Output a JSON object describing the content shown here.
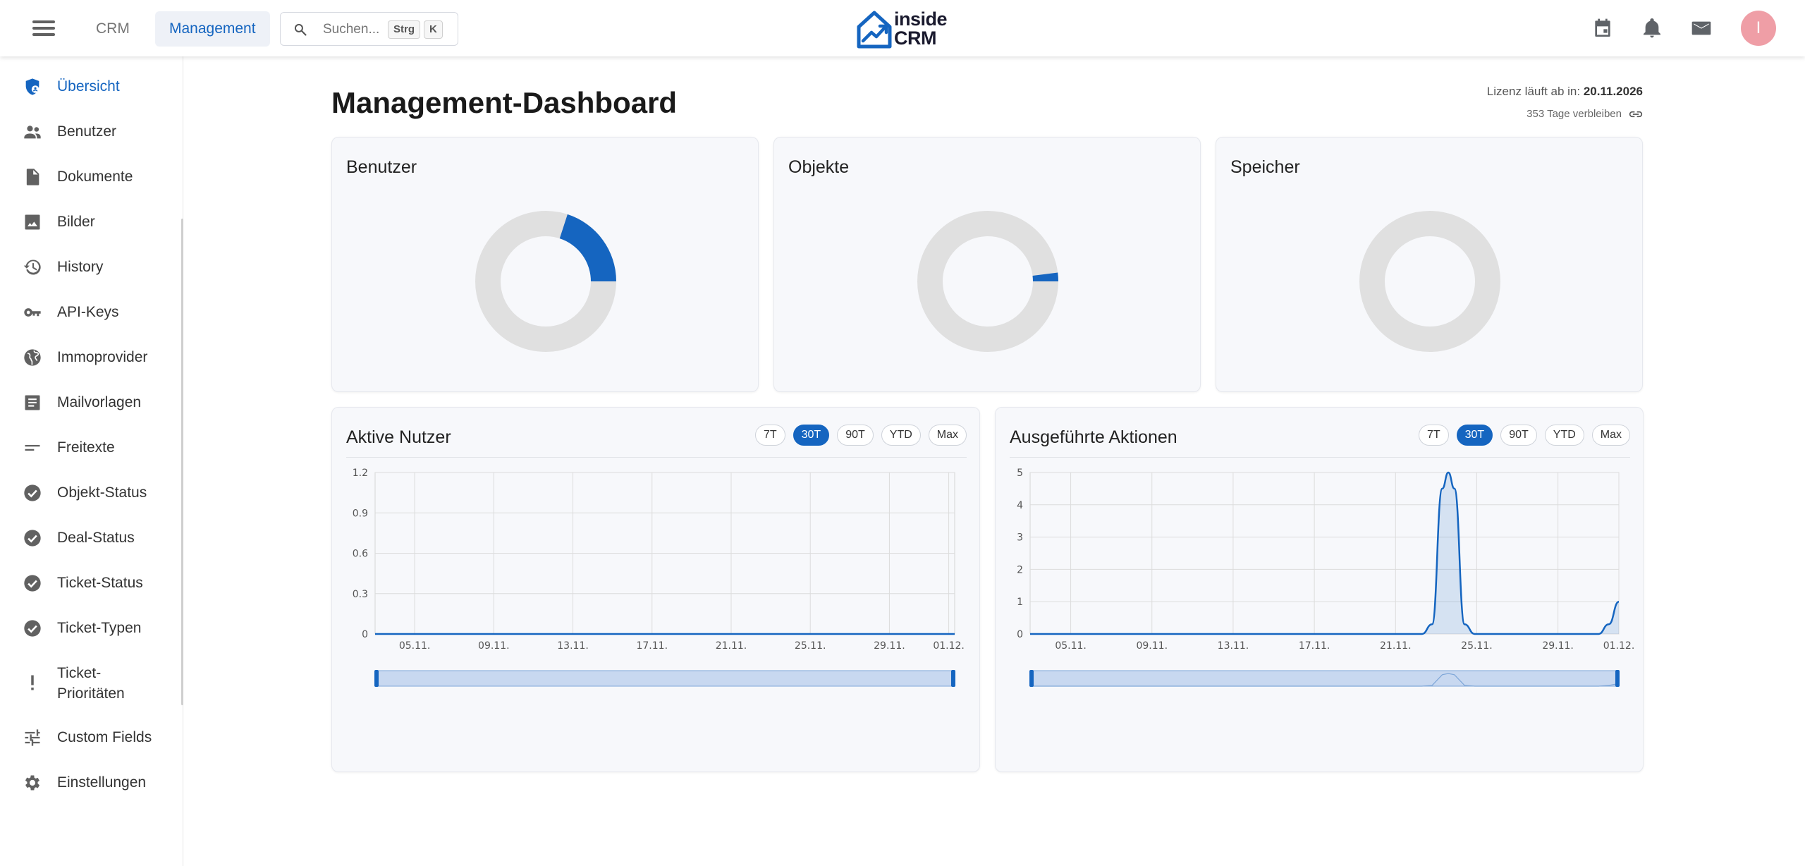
{
  "header": {
    "nav_crm": "CRM",
    "nav_management": "Management",
    "search_placeholder": "Suchen...",
    "kbd_1": "Strg",
    "kbd_2": "K",
    "logo_line1": "inside",
    "logo_line2": "CRM",
    "avatar_initial": "I",
    "avatar_color": "#ef9ea6",
    "icons": [
      "calendar-icon",
      "bell-icon",
      "mail-icon"
    ]
  },
  "sidebar": {
    "items": [
      {
        "label": "Übersicht",
        "icon": "shield-person-icon",
        "active": true
      },
      {
        "label": "Benutzer",
        "icon": "people-icon"
      },
      {
        "label": "Dokumente",
        "icon": "document-icon"
      },
      {
        "label": "Bilder",
        "icon": "image-icon"
      },
      {
        "label": "History",
        "icon": "history-icon"
      },
      {
        "label": "API-Keys",
        "icon": "key-icon"
      },
      {
        "label": "Immoprovider",
        "icon": "globe-icon"
      },
      {
        "label": "Mailvorlagen",
        "icon": "article-icon"
      },
      {
        "label": "Freitexte",
        "icon": "short-text-icon"
      },
      {
        "label": "Objekt-Status",
        "icon": "check-circle-icon"
      },
      {
        "label": "Deal-Status",
        "icon": "check-circle-icon"
      },
      {
        "label": "Ticket-Status",
        "icon": "check-circle-icon"
      },
      {
        "label": "Ticket-Typen",
        "icon": "check-circle-icon"
      },
      {
        "label": "Ticket-Prioritäten",
        "label_line1": "Ticket-",
        "label_line2": "Prioritäten",
        "icon": "exclamation-icon"
      },
      {
        "label": "Custom Fields",
        "icon": "tune-icon"
      },
      {
        "label": "Einstellungen",
        "icon": "gear-icon"
      }
    ]
  },
  "main": {
    "title": "Management-Dashboard",
    "license_label": "Lizenz läuft ab in:",
    "license_date": "20.11.2026",
    "days_remaining": "353 Tage verbleiben"
  },
  "colors": {
    "accent": "#1565c0",
    "donut_track": "#e0e0e0"
  },
  "cards": {
    "donuts": [
      {
        "title": "Benutzer",
        "fraction": 0.2
      },
      {
        "title": "Objekte",
        "fraction": 0.02
      },
      {
        "title": "Speicher",
        "fraction": 0.0
      }
    ]
  },
  "range_chips": [
    "7T",
    "30T",
    "90T",
    "YTD",
    "Max"
  ],
  "selected_chip": "30T",
  "chart_data": [
    {
      "type": "line",
      "title": "Aktive Nutzer",
      "x": [
        "05.11.",
        "09.11.",
        "13.11.",
        "17.11.",
        "21.11.",
        "25.11.",
        "29.11.",
        "01.12."
      ],
      "x_tick_days": [
        5,
        9,
        13,
        17,
        21,
        25,
        29,
        32
      ],
      "x_range_days": [
        3,
        32.3
      ],
      "yticks": [
        "0",
        "0.3",
        "0.6",
        "0.9",
        "1.2"
      ],
      "ylim": [
        0,
        1.2
      ],
      "series": [
        {
          "points": [
            [
              3,
              0
            ],
            [
              32.3,
              0
            ]
          ]
        }
      ],
      "grid": true,
      "zoom_slider": true
    },
    {
      "type": "area",
      "title": "Ausgeführte Aktionen",
      "x": [
        "05.11.",
        "09.11.",
        "13.11.",
        "17.11.",
        "21.11.",
        "25.11.",
        "29.11.",
        "01.12."
      ],
      "x_tick_days": [
        5,
        9,
        13,
        17,
        21,
        25,
        29,
        32
      ],
      "x_range_days": [
        3,
        32.0
      ],
      "yticks": [
        "0",
        "1",
        "2",
        "3",
        "4",
        "5"
      ],
      "ylim": [
        0,
        5
      ],
      "series": [
        {
          "points": [
            [
              3,
              0
            ],
            [
              22.3,
              0
            ],
            [
              22.8,
              0.3
            ],
            [
              23.3,
              4.5
            ],
            [
              23.6,
              5
            ],
            [
              23.9,
              4.5
            ],
            [
              24.4,
              0.3
            ],
            [
              24.9,
              0
            ],
            [
              31.0,
              0
            ],
            [
              31.5,
              0.3
            ],
            [
              32.0,
              1
            ]
          ]
        }
      ],
      "grid": true,
      "zoom_slider": true
    }
  ]
}
